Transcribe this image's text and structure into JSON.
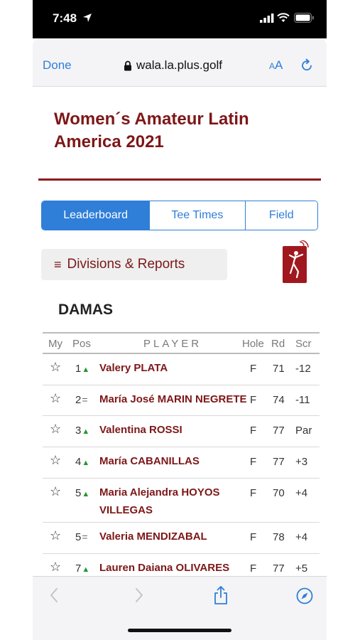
{
  "status": {
    "time": "7:48"
  },
  "browser": {
    "done_label": "Done",
    "url": "wala.la.plus.golf",
    "text_size_small": "A",
    "text_size_large": "A"
  },
  "page": {
    "title": "Women´s Amateur Latin America 2021",
    "tabs": [
      {
        "label": "Leaderboard",
        "active": true
      },
      {
        "label": "Tee Times",
        "active": false
      },
      {
        "label": "Field",
        "active": false
      }
    ],
    "divisions_label": "Divisions & Reports",
    "division": "DAMAS",
    "accent_color": "#7d1718",
    "link_color": "#2f7ed8"
  },
  "leaderboard": {
    "columns": {
      "my": "My",
      "pos": "Pos",
      "player": "PLAYER",
      "hole": "Hole",
      "rd": "Rd",
      "scr": "Scr"
    },
    "rows": [
      {
        "pos": "1",
        "move": "up",
        "name": "Valery PLATA",
        "name2": "",
        "hole": "F",
        "rd": "71",
        "scr": "-12"
      },
      {
        "pos": "2",
        "move": "same",
        "name": "María José MARIN NEGRETE",
        "name2": "",
        "hole": "F",
        "rd": "74",
        "scr": "-11"
      },
      {
        "pos": "3",
        "move": "up",
        "name": "Valentina ROSSI",
        "name2": "",
        "hole": "F",
        "rd": "77",
        "scr": "Par"
      },
      {
        "pos": "4",
        "move": "up",
        "name": "María CABANILLAS",
        "name2": "",
        "hole": "F",
        "rd": "77",
        "scr": "+3"
      },
      {
        "pos": "5",
        "move": "up",
        "name": "Maria Alejandra HOYOS",
        "name2": "VILLEGAS",
        "hole": "F",
        "rd": "70",
        "scr": "+4"
      },
      {
        "pos": "5",
        "move": "same",
        "name": "Valeria MENDIZABAL",
        "name2": "",
        "hole": "F",
        "rd": "78",
        "scr": "+4"
      },
      {
        "pos": "7",
        "move": "up",
        "name": "Lauren Daiana OLIVARES",
        "name2": "",
        "hole": "F",
        "rd": "77",
        "scr": "+5"
      }
    ]
  }
}
